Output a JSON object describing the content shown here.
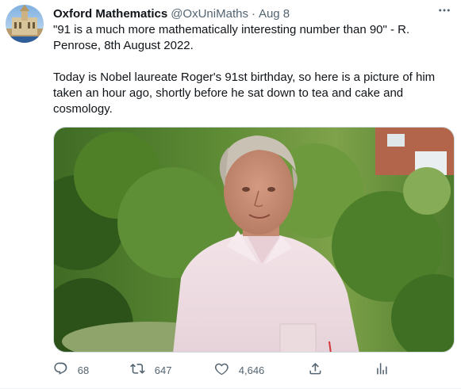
{
  "tweet": {
    "author_name": "Oxford Mathematics",
    "handle": "@OxUniMaths",
    "separator": "·",
    "date": "Aug 8",
    "paragraphs": [
      "\"91 is a much more mathematically interesting number than 90\" - R.\nPenrose, 8th August 2022.",
      "Today is Nobel laureate Roger's 91st birthday, so here is a picture of him\ntaken an hour ago, shortly before he sat down to tea and cake and\ncosmology."
    ]
  },
  "actions": {
    "reply_count": "68",
    "retweet_count": "647",
    "like_count": "4,646"
  },
  "icons": {
    "avatar": "oxford-building-avatar",
    "more": "more-horizontal-icon",
    "reply": "reply-icon",
    "retweet": "retweet-icon",
    "like": "heart-icon",
    "share": "share-icon",
    "analytics": "analytics-icon"
  },
  "colors": {
    "text_primary": "#0f1419",
    "text_secondary": "#536471",
    "border": "#cfd9de"
  }
}
